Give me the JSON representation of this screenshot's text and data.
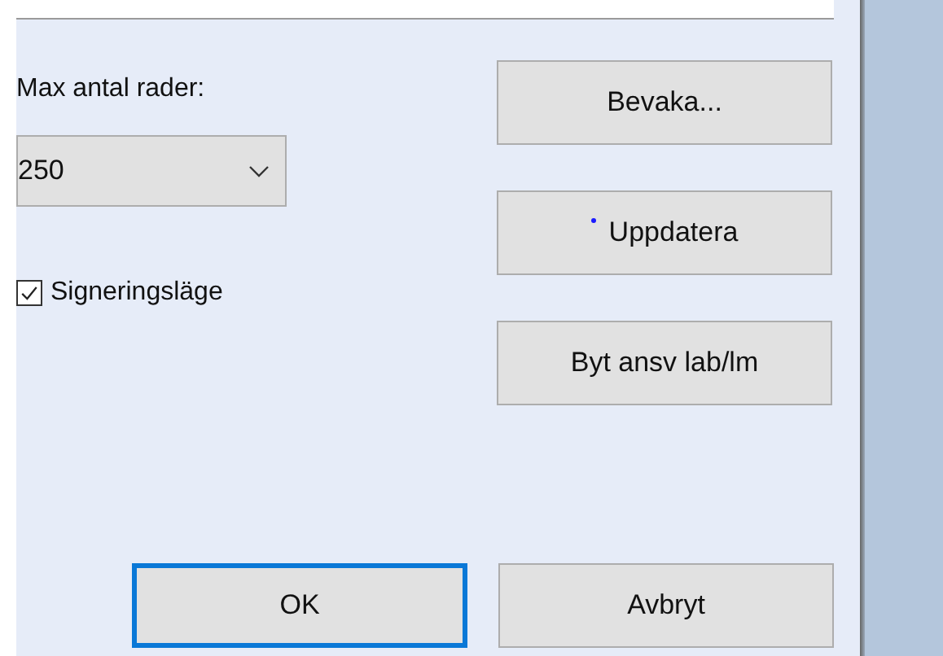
{
  "max_rows": {
    "label": "Max antal rader:",
    "value": "250"
  },
  "signing_mode": {
    "label": "Signeringsläge",
    "checked": true
  },
  "side_buttons": [
    {
      "label": "Bevaka...",
      "kind": "plain"
    },
    {
      "label": "Uppdatera",
      "kind": "dot"
    },
    {
      "label": "Byt ansv lab/lm",
      "kind": "plain"
    }
  ],
  "buttons": [
    {
      "label": "OK",
      "default": true
    },
    {
      "label": "Avbryt",
      "default": false
    }
  ]
}
